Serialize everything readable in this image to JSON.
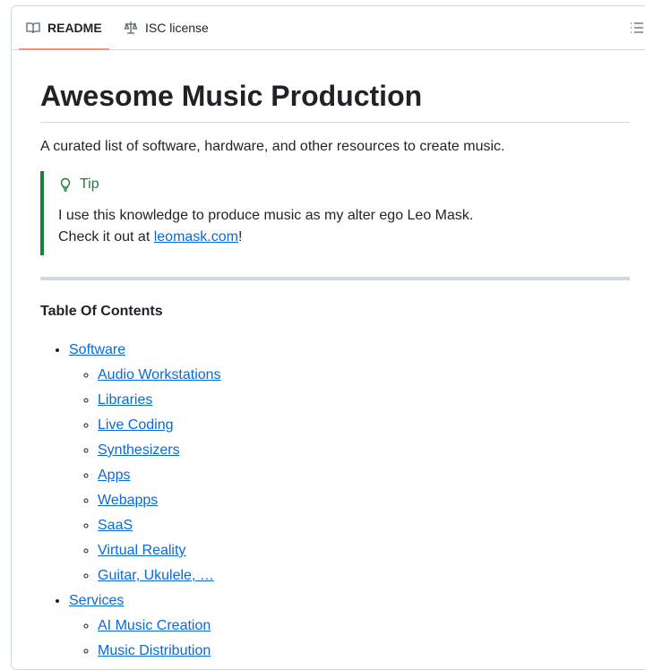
{
  "tabs": [
    {
      "label": "README"
    },
    {
      "label": "ISC license"
    }
  ],
  "title": "Awesome Music Production",
  "description": "A curated list of software, hardware, and other resources to create music.",
  "tip": {
    "title": "Tip",
    "line1": "I use this knowledge to produce music as my alter ego Leo Mask.",
    "line2_prefix": "Check it out at ",
    "link": "leomask.com",
    "line2_suffix": "!"
  },
  "toc": {
    "heading": "Table Of Contents",
    "items": [
      {
        "label": "Software",
        "children": [
          "Audio Workstations",
          "Libraries",
          "Live Coding",
          "Synthesizers",
          "Apps",
          "Webapps",
          "SaaS",
          "Virtual Reality",
          "Guitar, Ukulele, …"
        ]
      },
      {
        "label": "Services",
        "children": [
          "AI Music Creation",
          "Music Distribution"
        ]
      }
    ]
  }
}
